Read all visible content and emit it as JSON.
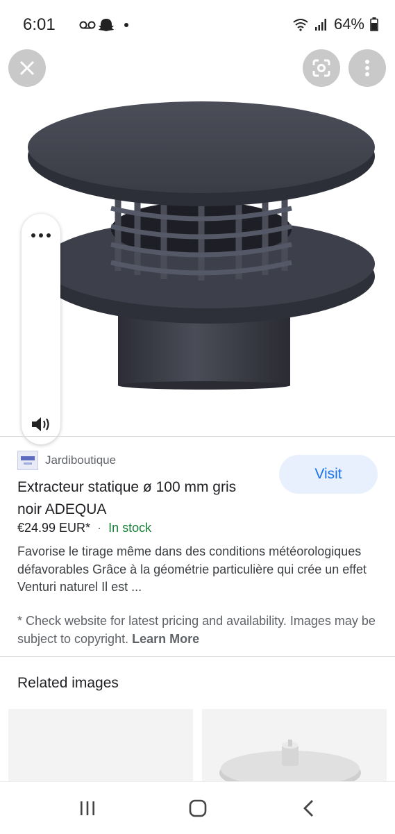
{
  "status_bar": {
    "time": "6:01",
    "battery": "64%",
    "icons_left": [
      "voicemail-icon",
      "snapchat-icon",
      "dot-icon"
    ],
    "icons_right": [
      "wifi-icon",
      "signal-icon",
      "battery-icon"
    ]
  },
  "viewer": {
    "close_icon": "close-icon",
    "lens_icon": "google-lens-icon",
    "menu_icon": "more-vert-icon",
    "side_menu_icon": "more-horiz-icon",
    "sound_icon": "volume-icon"
  },
  "product": {
    "source": "Jardiboutique",
    "title": "Extracteur statique ø 100 mm gris noir ADEQUA",
    "price": "€24.99 EUR*",
    "separator": "·",
    "availability": "In stock",
    "description": "Favorise le tirage même dans des conditions météorologiques défavorables Grâce à la géométrie particulière qui crée un effet Venturi naturel Il est ...",
    "visit_label": "Visit",
    "disclaimer": "* Check website for latest pricing and availability. Images may be subject to copyright.",
    "learn_more": "Learn More"
  },
  "related": {
    "title": "Related images"
  },
  "colors": {
    "accent": "#1a73e8",
    "visit_bg": "#e8f0fe",
    "in_stock": "#188038",
    "product_gray": "#3b3d47"
  },
  "nav_bar": {
    "recents_icon": "recents-icon",
    "home_icon": "home-icon",
    "back_icon": "back-icon"
  }
}
